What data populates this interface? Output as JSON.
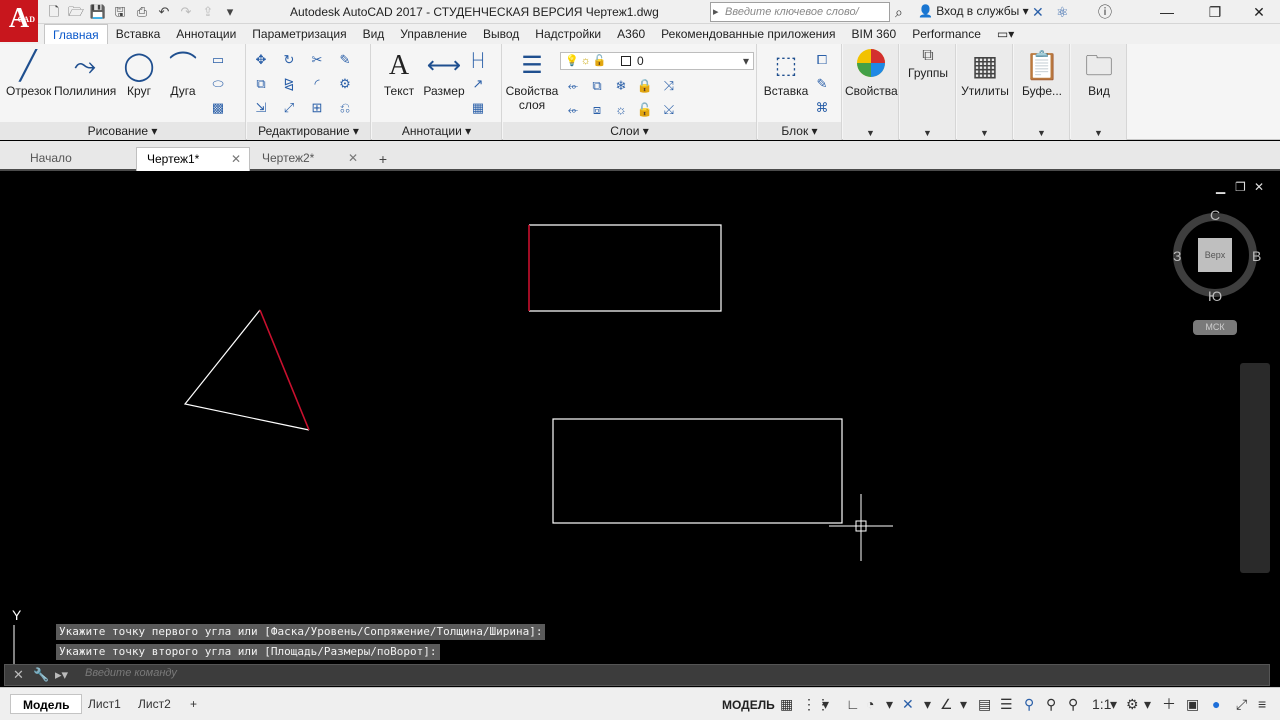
{
  "app": {
    "logo_letter": "A",
    "logo_suffix": "CAD",
    "title": "Autodesk AutoCAD 2017 - СТУДЕНЧЕСКАЯ ВЕРСИЯ    Чертеж1.dwg",
    "search_placeholder": "Введите ключевое слово/фразу",
    "signin": "Вход в службы",
    "win_min": "—",
    "win_max": "❐",
    "win_close": "✕"
  },
  "ribbon_tabs": [
    "Главная",
    "Вставка",
    "Аннотации",
    "Параметризация",
    "Вид",
    "Управление",
    "Вывод",
    "Надстройки",
    "A360",
    "Рекомендованные приложения",
    "BIM 360",
    "Performance"
  ],
  "ribbon": {
    "draw_panel": "Рисование",
    "line": "Отрезок",
    "polyline": "Полилиния",
    "circle": "Круг",
    "arc": "Дуга",
    "modify_panel": "Редактирование",
    "annot_panel": "Аннотации",
    "text": "Текст",
    "dimension": "Размер",
    "layers_panel": "Слои",
    "layer_props_line1": "Свойства",
    "layer_props_line2": "слоя",
    "current_layer": "0",
    "block_panel": "Блок",
    "insert": "Вставка",
    "properties": "Свойства",
    "groups": "Группы",
    "utilities": "Утилиты",
    "clipboard": "Буфе...",
    "view": "Вид"
  },
  "file_tabs": {
    "start": "Начало",
    "drawing1": "Чертеж1*",
    "drawing2": "Чертеж2*",
    "close_mark": "✕",
    "add": "+"
  },
  "viewcube": {
    "north": "С",
    "south": "Ю",
    "east": "В",
    "west": "З",
    "top_face": "Верх",
    "ucs": "МСК"
  },
  "ucs_axis_label": "Y",
  "command": {
    "history": [
      "Укажите точку первого угла или [Фаска/Уровень/Сопряжение/Толщина/Ширина]:",
      "Укажите точку второго угла или [Площадь/Размеры/поВорот]:"
    ],
    "input_placeholder": "Введите команду"
  },
  "status": {
    "layout_tabs": [
      "Модель",
      "Лист1",
      "Лист2"
    ],
    "add_tab": "+",
    "model_label": "МОДЕЛЬ",
    "scale": "1:1"
  },
  "colors": {
    "canvas_bg": "#000000",
    "geometry": "#ffffff",
    "highlight_edge": "#c8102e",
    "accent_tab": "#0a58ca"
  }
}
